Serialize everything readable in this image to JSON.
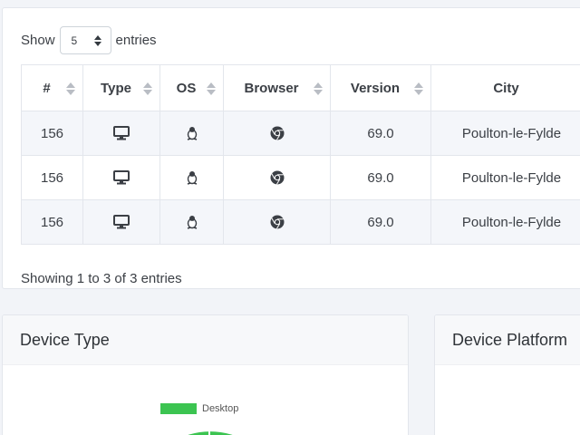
{
  "length": {
    "show_label": "Show",
    "value": "5",
    "entries_label": "entries"
  },
  "table": {
    "columns": [
      "#",
      "Type",
      "OS",
      "Browser",
      "Version",
      "City"
    ],
    "rows": [
      {
        "num": "156",
        "type_icon": "desktop-icon",
        "os_icon": "linux-icon",
        "browser_icon": "chrome-icon",
        "version": "69.0",
        "city": "Poulton-le-Fylde"
      },
      {
        "num": "156",
        "type_icon": "desktop-icon",
        "os_icon": "linux-icon",
        "browser_icon": "chrome-icon",
        "version": "69.0",
        "city": "Poulton-le-Fylde"
      },
      {
        "num": "156",
        "type_icon": "desktop-icon",
        "os_icon": "linux-icon",
        "browser_icon": "chrome-icon",
        "version": "69.0",
        "city": "Poulton-le-Fylde"
      }
    ],
    "info": "Showing 1 to 3 of 3 entries"
  },
  "device_type": {
    "title": "Device Type",
    "legend": "Desktop",
    "legend_color": "#3cc451"
  },
  "device_platform": {
    "title": "Device Platform"
  }
}
